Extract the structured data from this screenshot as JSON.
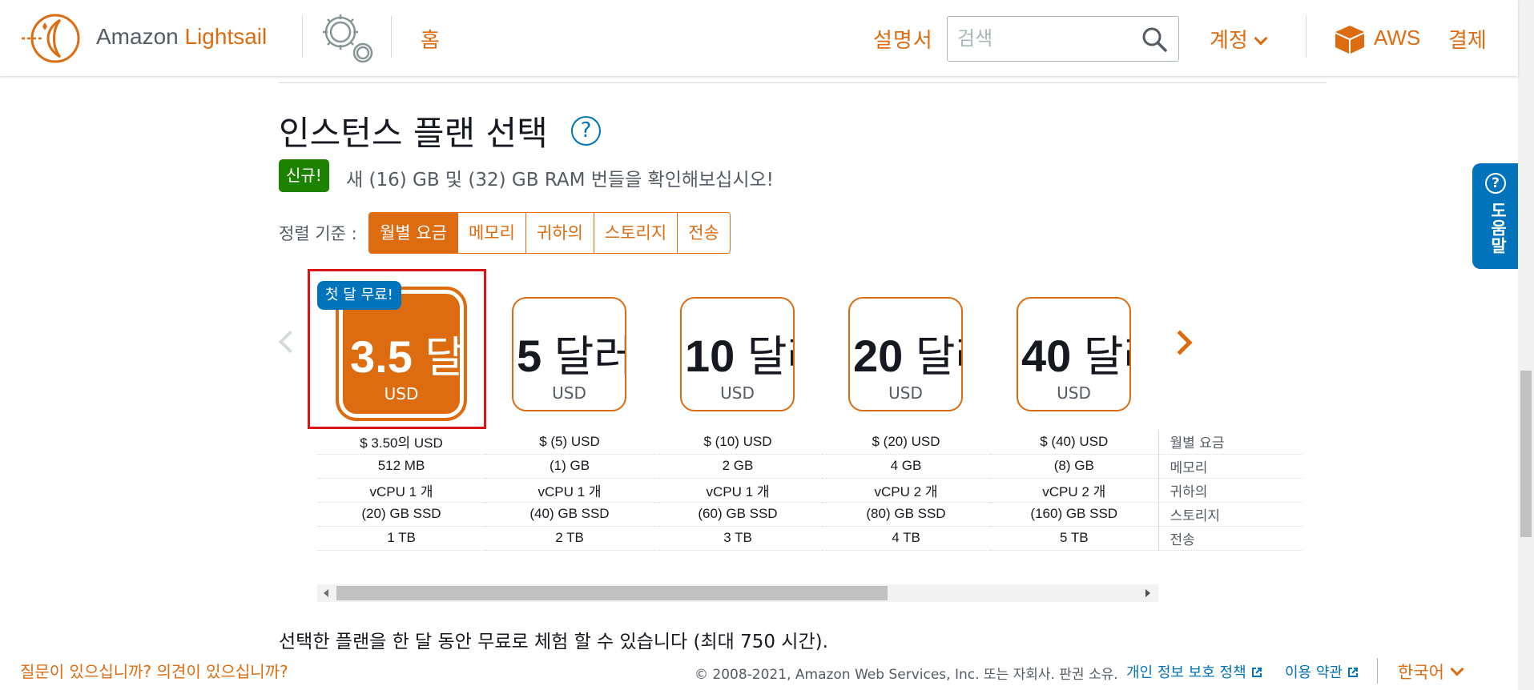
{
  "header": {
    "brand_prefix": "Amazon",
    "brand_product": "Lightsail",
    "home": "홈",
    "docs": "설명서",
    "search_placeholder": "검색",
    "account": "계정",
    "aws": "AWS",
    "billing": "결제"
  },
  "page": {
    "title": "인스턴스 플랜 선택",
    "help_symbol": "?",
    "new_badge": "신규!",
    "new_text": "새 (16) GB 및 (32) GB RAM 번들을 확인해보십시오!",
    "sort_label": "정렬 기준 :",
    "sort_options": [
      "월별 요금",
      "메모리",
      "귀하의",
      "스토리지",
      "전송"
    ],
    "sort_active": "월별 요금",
    "trial_text": "선택한 플랜을 한 달 동안 무료로 체험 할 수 있습니다 (최대 750 시간)."
  },
  "plans": {
    "free_badge": "첫 달 무료!",
    "cards": [
      {
        "price": "3.5",
        "unit": "달러",
        "currency": "USD",
        "selected": true
      },
      {
        "price": "5",
        "unit": "달러",
        "currency": "USD"
      },
      {
        "price": "10",
        "unit": "달러",
        "currency": "USD"
      },
      {
        "price": "20",
        "unit": "달러",
        "currency": "USD"
      },
      {
        "price": "40",
        "unit": "달러",
        "currency": "USD"
      }
    ],
    "row_labels": [
      "월별 요금",
      "메모리",
      "귀하의",
      "스토리지",
      "전송"
    ],
    "rows": [
      [
        "$ 3.50의 USD",
        "$ (5) USD",
        "$ (10) USD",
        "$ (20) USD",
        "$ (40) USD"
      ],
      [
        "512 MB",
        "(1) GB",
        "2 GB",
        "4 GB",
        "(8) GB"
      ],
      [
        "vCPU 1 개",
        "vCPU 1 개",
        "vCPU 1 개",
        "vCPU 2 개",
        "vCPU 2 개"
      ],
      [
        "(20) GB SSD",
        "(40) GB SSD",
        "(60) GB SSD",
        "(80) GB SSD",
        "(160) GB SSD"
      ],
      [
        "1 TB",
        "2 TB",
        "3 TB",
        "4 TB",
        "5 TB"
      ]
    ]
  },
  "help_tab": {
    "symbol": "?",
    "label": "도움말"
  },
  "footer": {
    "question": "질문이 있으십니까? 의견이 있으십니까?",
    "copyright": "© 2008-2021, Amazon Web Services, Inc. 또는 자회사. 판권 소유.",
    "privacy": "개인 정보 보호 정책",
    "terms": "이용 약관",
    "language": "한국어"
  },
  "colors": {
    "accent": "#dd6b10",
    "link": "#0073bb",
    "new_badge": "#1d8102",
    "selection_frame": "#d91515"
  }
}
